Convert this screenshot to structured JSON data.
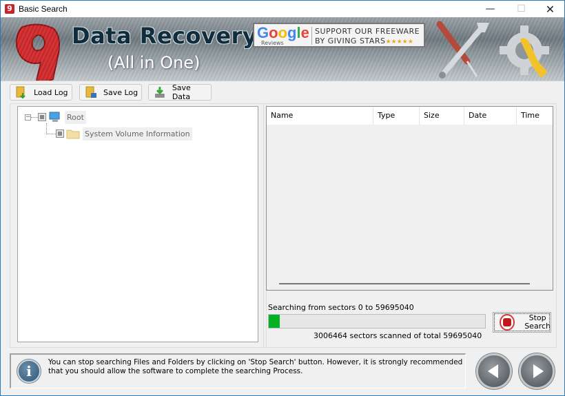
{
  "window": {
    "title": "Basic Search",
    "app_icon_glyph": "9",
    "controls": {
      "minimize": "—",
      "maximize": "☐",
      "close": "✕"
    }
  },
  "banner": {
    "title": "Data Recovery",
    "subtitle": "(All in One)",
    "google_badge": {
      "logo_letters": [
        {
          "ch": "G",
          "color": "#4285f4"
        },
        {
          "ch": "o",
          "color": "#ea4335"
        },
        {
          "ch": "o",
          "color": "#fbbc05"
        },
        {
          "ch": "g",
          "color": "#4285f4"
        },
        {
          "ch": "l",
          "color": "#34a853"
        },
        {
          "ch": "e",
          "color": "#ea4335"
        }
      ],
      "reviews_label": "Reviews",
      "line1": "SUPPORT OUR FREEWARE",
      "line2": "BY GIVING STARS",
      "stars": "★★★★★"
    }
  },
  "toolbar": {
    "load_log": "Load Log",
    "save_log": "Save Log",
    "save_data": "Save Data"
  },
  "tree": {
    "root": {
      "label": "Root",
      "expander": "−"
    },
    "children": [
      {
        "label": "System Volume Information"
      }
    ]
  },
  "file_list": {
    "columns": [
      "Name",
      "Type",
      "Size",
      "Date",
      "Time"
    ],
    "rows": []
  },
  "search": {
    "range_label": "Searching from sectors   0 to 59695040",
    "progress_fraction": 0.0504,
    "scanned_caption": "3006464  sectors scanned of total 59695040",
    "stop_button_line1": "Stop",
    "stop_button_line2": "Search"
  },
  "info": {
    "icon_glyph": "i",
    "message": "You can stop searching Files and Folders by clicking on 'Stop Search' button. However, it is strongly recommended that you should allow the software to complete the searching Process."
  },
  "colors": {
    "progress_fill": "#06b025",
    "stop_red": "#c0161d",
    "window_border": "#2b79b9"
  }
}
